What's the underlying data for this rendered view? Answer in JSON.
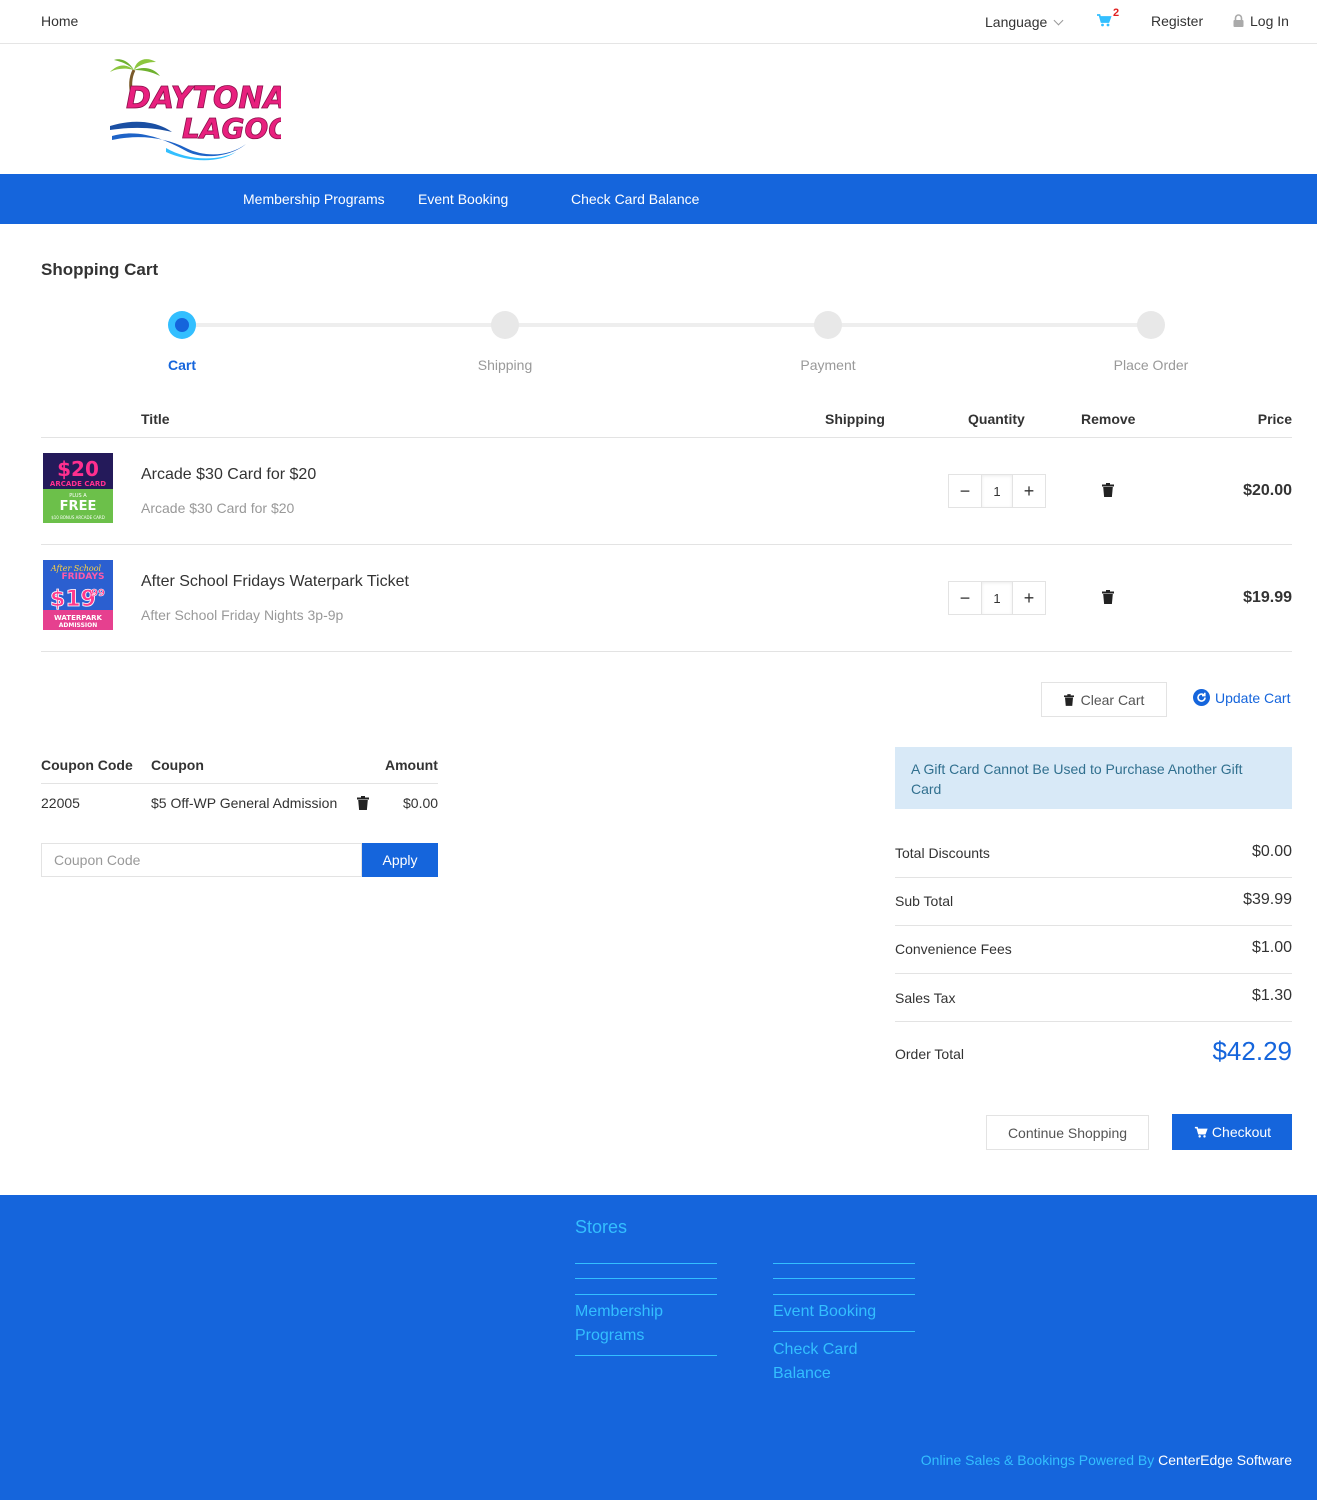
{
  "topbar": {
    "home": "Home",
    "language": "Language",
    "cart_count": "2",
    "register": "Register",
    "login": "Log In"
  },
  "nav": {
    "items": [
      "Membership Programs",
      "Event Booking",
      "Check Card Balance"
    ]
  },
  "page_title": "Shopping Cart",
  "steps": [
    "Cart",
    "Shipping",
    "Payment",
    "Place Order"
  ],
  "table_headers": {
    "title": "Title",
    "shipping": "Shipping",
    "quantity": "Quantity",
    "remove": "Remove",
    "price": "Price"
  },
  "items": [
    {
      "title": "Arcade $30 Card for $20",
      "subtitle": "Arcade $30 Card for $20",
      "quantity": "1",
      "price": "$20.00",
      "image_text": {
        "price": "$20",
        "line1": "ARCADE CARD",
        "line2": "PLUS A",
        "line3": "FREE",
        "line4": "$10 BONUS ARCADE CARD"
      }
    },
    {
      "title": "After School Fridays Waterpark Ticket",
      "subtitle": "After School Friday Nights 3p-9p",
      "quantity": "1",
      "price": "$19.99",
      "image_text": {
        "line1": "After School",
        "line2": "FRIDAYS",
        "price": "$19",
        "cents": "99",
        "line3": "WATERPARK",
        "line4": "ADMISSION"
      }
    }
  ],
  "cart_actions": {
    "clear": "Clear Cart",
    "update": "Update Cart"
  },
  "coupon": {
    "headers": {
      "code": "Coupon Code",
      "coupon": "Coupon",
      "amount": "Amount"
    },
    "rows": [
      {
        "code": "22005",
        "coupon": "$5 Off-WP General Admission",
        "amount": "$0.00"
      }
    ],
    "input_placeholder": "Coupon Code",
    "apply": "Apply"
  },
  "summary": {
    "alert": "A Gift Card Cannot Be Used to Purchase Another Gift Card",
    "total_discounts_label": "Total Discounts",
    "total_discounts": "$0.00",
    "sub_total_label": "Sub Total",
    "sub_total": "$39.99",
    "convenience_fees_label": "Convenience Fees",
    "convenience_fees": "$1.00",
    "sales_tax_label": "Sales Tax",
    "sales_tax": "$1.30",
    "order_total_label": "Order Total",
    "order_total": "$42.29"
  },
  "buttons": {
    "continue": "Continue Shopping",
    "checkout": "Checkout"
  },
  "footer": {
    "stores": "Stores",
    "links": [
      "Membership Programs",
      "Event Booking",
      "Check Card Balance"
    ],
    "powered_prefix": "Online Sales & Bookings Powered By",
    "powered_brand": "CenterEdge Software"
  },
  "logo": {
    "line1": "DAYTONA",
    "line2": "LAGOON"
  },
  "colors": {
    "primary": "#1565dc",
    "accent": "#33bfff",
    "logo_pink": "#e8207e",
    "badge_red": "#e02020"
  }
}
